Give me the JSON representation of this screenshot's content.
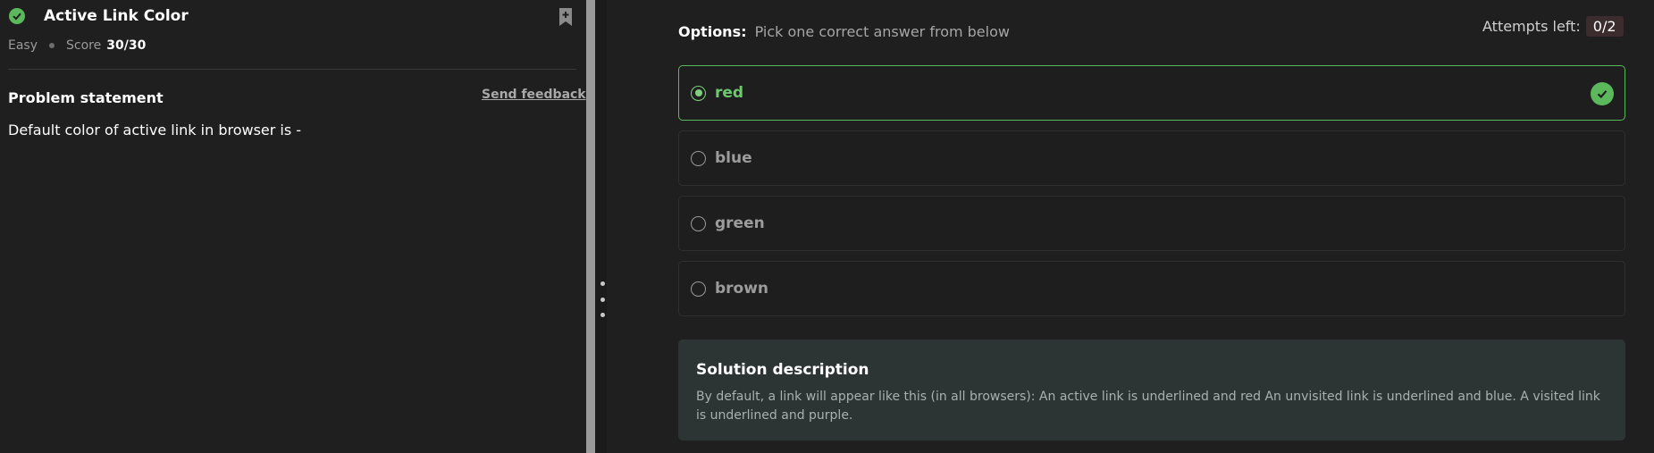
{
  "problem": {
    "title": "Active Link Color",
    "difficulty": "Easy",
    "score_label": "Score",
    "score_value": "30/30",
    "section_heading": "Problem statement",
    "feedback_link": "Send feedback",
    "question": "Default color of active link in browser is -"
  },
  "options_panel": {
    "label": "Options:",
    "hint": "Pick one correct answer from below",
    "attempts_label": "Attempts left:",
    "attempts_value": "0/2",
    "options": [
      {
        "label": "red",
        "selected": true,
        "correct": true
      },
      {
        "label": "blue",
        "selected": false,
        "correct": false
      },
      {
        "label": "green",
        "selected": false,
        "correct": false
      },
      {
        "label": "brown",
        "selected": false,
        "correct": false
      }
    ]
  },
  "solution": {
    "title": "Solution description",
    "text": "By default, a link will appear like this (in all browsers): An active link is underlined and red An unvisited link is underlined and blue. A visited link is underlined and purple."
  },
  "icons": {
    "status": "check-circle-icon",
    "bookmark": "bookmark-add-icon",
    "correct": "check-circle-icon",
    "drag": "drag-handle-icon"
  },
  "colors": {
    "background": "#1f1f1f",
    "success": "#5cb85c",
    "solution_bg": "#2c3434",
    "attempts_badge": "#3d2c2e"
  }
}
